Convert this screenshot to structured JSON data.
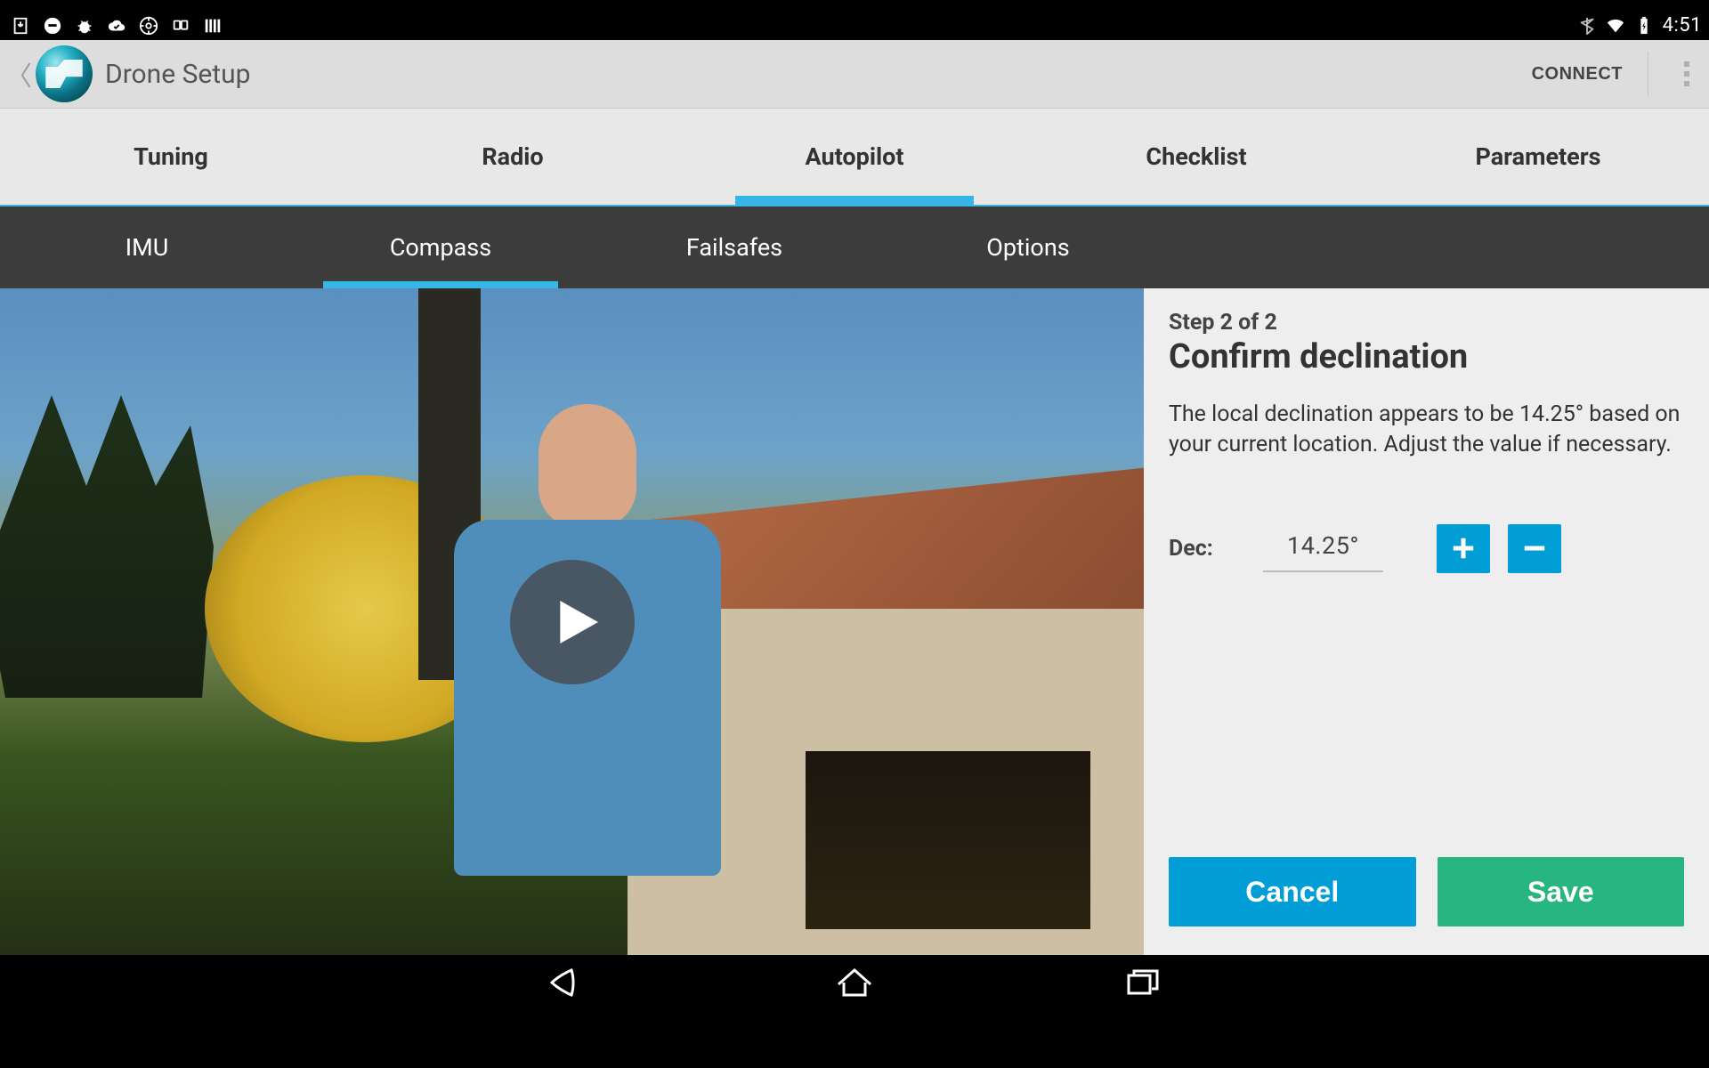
{
  "status_bar": {
    "clock": "4:51"
  },
  "action_bar": {
    "title": "Drone Setup",
    "connect_label": "CONNECT"
  },
  "main_tabs": [
    {
      "label": "Tuning",
      "active": false
    },
    {
      "label": "Radio",
      "active": false
    },
    {
      "label": "Autopilot",
      "active": true
    },
    {
      "label": "Checklist",
      "active": false
    },
    {
      "label": "Parameters",
      "active": false
    }
  ],
  "sub_tabs": [
    {
      "label": "IMU",
      "active": false
    },
    {
      "label": "Compass",
      "active": true
    },
    {
      "label": "Failsafes",
      "active": false
    },
    {
      "label": "Options",
      "active": false
    }
  ],
  "panel": {
    "step": "Step 2 of 2",
    "title": "Confirm declination",
    "description": "The local declination appears to be 14.25° based on your current location. Adjust the value if necessary.",
    "dec_label": "Dec:",
    "dec_value": "14.25°",
    "cancel_label": "Cancel",
    "save_label": "Save"
  }
}
